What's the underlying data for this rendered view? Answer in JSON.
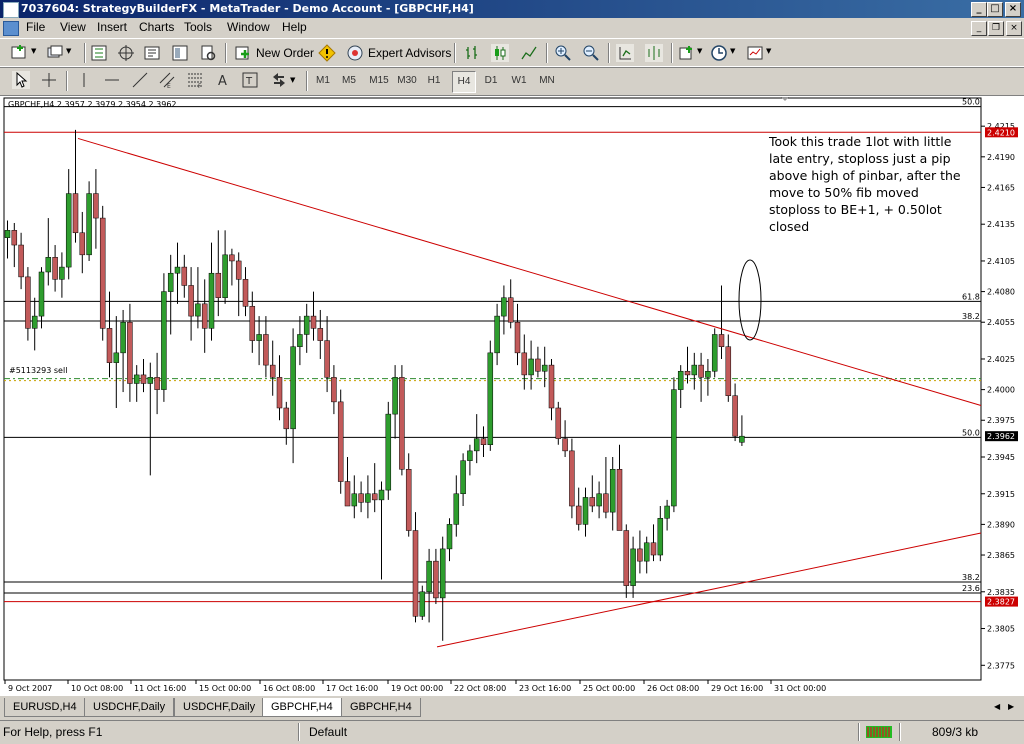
{
  "window": {
    "title": "7037604: StrategyBuilderFX - MetaTrader - Demo Account - [GBPCHF,H4]"
  },
  "menu": [
    "File",
    "View",
    "Insert",
    "Charts",
    "Tools",
    "Window",
    "Help"
  ],
  "toolbar1": {
    "new_order": "New Order",
    "expert_advisors": "Expert Advisors"
  },
  "timeframes": [
    "M1",
    "M5",
    "M15",
    "M30",
    "H1",
    "H4",
    "D1",
    "W1",
    "MN"
  ],
  "active_timeframe": "H4",
  "chart": {
    "header": "GBPCHF,H4  2.3957 2.3979 2.3954 2.3962",
    "annotation": [
      "Took this trade 1lot with little",
      "late entry, stoploss just a pip",
      "above high of pinbar, after the",
      "move to 50% fib moved",
      "stoploss to BE+1, + 0.50lot",
      "closed"
    ],
    "order_label": "#5113293 sell",
    "price_ticks": [
      "2.4215",
      "2.4190",
      "2.4165",
      "2.4135",
      "2.4105",
      "2.4080",
      "2.4055",
      "2.4025",
      "2.4000",
      "2.3975",
      "2.3945",
      "2.3915",
      "2.3890",
      "2.3865",
      "2.3835",
      "2.3805",
      "2.3775"
    ],
    "time_ticks": [
      "9 Oct 2007",
      "10 Oct 08:00",
      "11 Oct 16:00",
      "15 Oct 00:00",
      "16 Oct 08:00",
      "17 Oct 16:00",
      "19 Oct 00:00",
      "22 Oct 08:00",
      "23 Oct 16:00",
      "25 Oct 00:00",
      "26 Oct 08:00",
      "29 Oct 16:00",
      "31 Oct 00:00"
    ],
    "fib_levels": [
      {
        "label": "50.0",
        "price": 2.4231
      },
      {
        "label": "61.8",
        "price": 2.4072
      },
      {
        "label": "38.2",
        "price": 2.4056
      },
      {
        "label": "50.0",
        "price": 2.3961
      },
      {
        "label": "38.2",
        "price": 2.3843
      },
      {
        "label": "23.6",
        "price": 2.3834
      }
    ],
    "price_labels": [
      {
        "text": "2.4210",
        "price": 2.421,
        "color": "#cc0000"
      },
      {
        "text": "2.3962",
        "price": 2.3962,
        "color": "#000000"
      },
      {
        "text": "2.3827",
        "price": 2.3827,
        "color": "#cc0000"
      }
    ],
    "colors": {
      "bull": "#2e9d2e",
      "bear": "#c25a5a",
      "resistance": "#cc0000",
      "order_line": "#2e8b2e",
      "sl_line": "#c8a000"
    }
  },
  "chart_data": {
    "type": "candlestick",
    "ylim": [
      2.3763,
      2.4238
    ],
    "order_price": 2.4009,
    "candles_ohlc": [
      [
        2.4124,
        2.4138,
        2.4107,
        2.413
      ],
      [
        2.413,
        2.4136,
        2.41,
        2.4118
      ],
      [
        2.4118,
        2.4128,
        2.4082,
        2.4092
      ],
      [
        2.4092,
        2.41,
        2.404,
        2.405
      ],
      [
        2.405,
        2.4075,
        2.4032,
        2.406
      ],
      [
        2.406,
        2.41,
        2.405,
        2.4096
      ],
      [
        2.4096,
        2.414,
        2.4085,
        2.4108
      ],
      [
        2.4108,
        2.4118,
        2.408,
        2.409
      ],
      [
        2.409,
        2.4112,
        2.4075,
        2.41
      ],
      [
        2.41,
        2.418,
        2.409,
        2.416
      ],
      [
        2.416,
        2.4212,
        2.412,
        2.4128
      ],
      [
        2.4128,
        2.4145,
        2.4095,
        2.411
      ],
      [
        2.411,
        2.417,
        2.4105,
        2.416
      ],
      [
        2.416,
        2.418,
        2.4115,
        2.414
      ],
      [
        2.414,
        2.415,
        2.404,
        2.405
      ],
      [
        2.405,
        2.408,
        2.401,
        2.4022
      ],
      [
        2.4022,
        2.406,
        2.3985,
        2.403
      ],
      [
        2.403,
        2.4065,
        2.3998,
        2.4055
      ],
      [
        2.4055,
        2.407,
        2.399,
        2.4005
      ],
      [
        2.4005,
        2.402,
        2.399,
        2.4012
      ],
      [
        2.4012,
        2.4025,
        2.3998,
        2.4005
      ],
      [
        2.4005,
        2.4022,
        2.393,
        2.401
      ],
      [
        2.401,
        2.403,
        2.398,
        2.4
      ],
      [
        2.4,
        2.4095,
        2.399,
        2.408
      ],
      [
        2.408,
        2.411,
        2.4045,
        2.4095
      ],
      [
        2.4095,
        2.412,
        2.407,
        2.41
      ],
      [
        2.41,
        2.411,
        2.4075,
        2.4085
      ],
      [
        2.4085,
        2.41,
        2.404,
        2.406
      ],
      [
        2.406,
        2.41,
        2.405,
        2.407
      ],
      [
        2.407,
        2.409,
        2.403,
        2.405
      ],
      [
        2.405,
        2.412,
        2.404,
        2.4095
      ],
      [
        2.4095,
        2.413,
        2.406,
        2.4075
      ],
      [
        2.4075,
        2.413,
        2.407,
        2.411
      ],
      [
        2.411,
        2.4115,
        2.4085,
        2.4105
      ],
      [
        2.4105,
        2.4112,
        2.406,
        2.409
      ],
      [
        2.409,
        2.41,
        2.406,
        2.4068
      ],
      [
        2.4068,
        2.408,
        2.403,
        2.404
      ],
      [
        2.404,
        2.406,
        2.402,
        2.4045
      ],
      [
        2.4045,
        2.406,
        2.401,
        2.402
      ],
      [
        2.402,
        2.404,
        2.3995,
        2.401
      ],
      [
        2.401,
        2.4028,
        2.3975,
        2.3985
      ],
      [
        2.3985,
        2.399,
        2.3955,
        2.3968
      ],
      [
        2.3968,
        2.405,
        2.394,
        2.4035
      ],
      [
        2.4035,
        2.406,
        2.402,
        2.4045
      ],
      [
        2.4045,
        2.407,
        2.403,
        2.406
      ],
      [
        2.406,
        2.408,
        2.404,
        2.405
      ],
      [
        2.405,
        2.4065,
        2.4025,
        2.404
      ],
      [
        2.404,
        2.406,
        2.3998,
        2.401
      ],
      [
        2.401,
        2.402,
        2.398,
        2.399
      ],
      [
        2.399,
        2.4,
        2.3915,
        2.3925
      ],
      [
        2.3925,
        2.3945,
        2.3905,
        2.3905
      ],
      [
        2.3905,
        2.393,
        2.3895,
        2.3915
      ],
      [
        2.3915,
        2.3925,
        2.39,
        2.3908
      ],
      [
        2.3908,
        2.393,
        2.3895,
        2.3915
      ],
      [
        2.3915,
        2.394,
        2.39,
        2.391
      ],
      [
        2.391,
        2.3925,
        2.3845,
        2.3918
      ],
      [
        2.3918,
        2.399,
        2.391,
        2.398
      ],
      [
        2.398,
        2.402,
        2.396,
        2.401
      ],
      [
        2.401,
        2.402,
        2.393,
        2.3935
      ],
      [
        2.3935,
        2.3948,
        2.388,
        2.3885
      ],
      [
        2.3885,
        2.39,
        2.381,
        2.3815
      ],
      [
        2.3815,
        2.384,
        2.3812,
        2.3835
      ],
      [
        2.3835,
        2.387,
        2.381,
        2.386
      ],
      [
        2.386,
        2.387,
        2.3825,
        2.383
      ],
      [
        2.383,
        2.388,
        2.3795,
        2.387
      ],
      [
        2.387,
        2.3895,
        2.386,
        2.389
      ],
      [
        2.389,
        2.393,
        2.388,
        2.3915
      ],
      [
        2.3915,
        2.3948,
        2.3905,
        2.3942
      ],
      [
        2.3942,
        2.3955,
        2.393,
        2.395
      ],
      [
        2.395,
        2.398,
        2.394,
        2.396
      ],
      [
        2.396,
        2.397,
        2.3945,
        2.3955
      ],
      [
        2.3955,
        2.404,
        2.395,
        2.403
      ],
      [
        2.403,
        2.407,
        2.402,
        2.406
      ],
      [
        2.406,
        2.4085,
        2.4045,
        2.4075
      ],
      [
        2.4075,
        2.409,
        2.405,
        2.4055
      ],
      [
        2.4055,
        2.407,
        2.402,
        2.403
      ],
      [
        2.403,
        2.4045,
        2.4,
        2.4012
      ],
      [
        2.4012,
        2.404,
        2.4,
        2.4025
      ],
      [
        2.4025,
        2.4035,
        2.401,
        2.4015
      ],
      [
        2.4015,
        2.4035,
        2.4002,
        2.402
      ],
      [
        2.402,
        2.4025,
        2.3975,
        2.3985
      ],
      [
        2.3985,
        2.399,
        2.3955,
        2.396
      ],
      [
        2.396,
        2.3975,
        2.3945,
        2.395
      ],
      [
        2.395,
        2.396,
        2.3895,
        2.3905
      ],
      [
        2.3905,
        2.392,
        2.3885,
        2.389
      ],
      [
        2.389,
        2.392,
        2.388,
        2.3912
      ],
      [
        2.3912,
        2.393,
        2.39,
        2.3905
      ],
      [
        2.3905,
        2.3925,
        2.3895,
        2.3915
      ],
      [
        2.3915,
        2.3945,
        2.3895,
        2.39
      ],
      [
        2.39,
        2.3945,
        2.3885,
        2.3935
      ],
      [
        2.3935,
        2.3955,
        2.389,
        2.3885
      ],
      [
        2.3885,
        2.389,
        2.383,
        2.384
      ],
      [
        2.384,
        2.388,
        2.383,
        2.387
      ],
      [
        2.387,
        2.3885,
        2.385,
        2.386
      ],
      [
        2.386,
        2.388,
        2.385,
        2.3875
      ],
      [
        2.3875,
        2.389,
        2.386,
        2.3865
      ],
      [
        2.3865,
        2.3905,
        2.386,
        2.3895
      ],
      [
        2.3895,
        2.391,
        2.3885,
        2.3905
      ],
      [
        2.3905,
        2.401,
        2.39,
        2.4
      ],
      [
        2.4,
        2.402,
        2.3985,
        2.4015
      ],
      [
        2.4015,
        2.4035,
        2.4005,
        2.4012
      ],
      [
        2.4012,
        2.403,
        2.4,
        2.402
      ],
      [
        2.402,
        2.403,
        2.399,
        2.401
      ],
      [
        2.401,
        2.4025,
        2.3995,
        2.4015
      ],
      [
        2.4015,
        2.405,
        2.401,
        2.4045
      ],
      [
        2.4045,
        2.4085,
        2.4025,
        2.4035
      ],
      [
        2.4035,
        2.4045,
        2.399,
        2.3995
      ],
      [
        2.3995,
        2.4005,
        2.3958,
        2.3962
      ],
      [
        2.3957,
        2.3979,
        2.3954,
        2.3962
      ]
    ]
  },
  "tabs": [
    "EURUSD,H4",
    "USDCHF,Daily",
    "USDCHF,Daily",
    "GBPCHF,H4",
    "GBPCHF,H4"
  ],
  "active_tab": 3,
  "status": {
    "help": "For Help, press F1",
    "profile": "Default",
    "traffic": "809/3 kb"
  }
}
